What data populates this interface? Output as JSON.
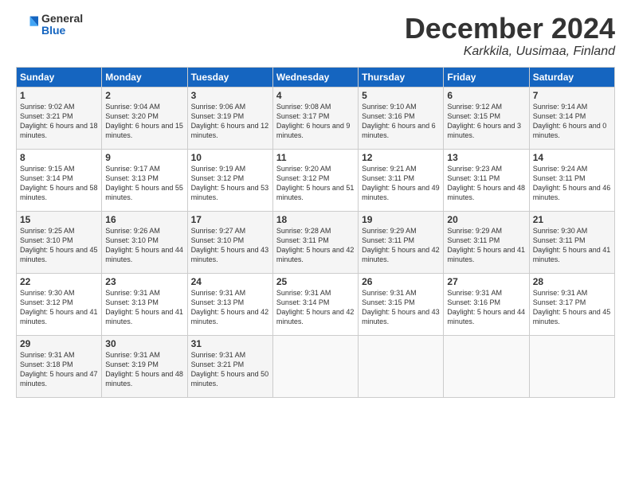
{
  "header": {
    "logo_general": "General",
    "logo_blue": "Blue",
    "month": "December 2024",
    "location": "Karkkila, Uusimaa, Finland"
  },
  "days_of_week": [
    "Sunday",
    "Monday",
    "Tuesday",
    "Wednesday",
    "Thursday",
    "Friday",
    "Saturday"
  ],
  "weeks": [
    [
      {
        "day": "1",
        "sunrise": "Sunrise: 9:02 AM",
        "sunset": "Sunset: 3:21 PM",
        "daylight": "Daylight: 6 hours and 18 minutes."
      },
      {
        "day": "2",
        "sunrise": "Sunrise: 9:04 AM",
        "sunset": "Sunset: 3:20 PM",
        "daylight": "Daylight: 6 hours and 15 minutes."
      },
      {
        "day": "3",
        "sunrise": "Sunrise: 9:06 AM",
        "sunset": "Sunset: 3:19 PM",
        "daylight": "Daylight: 6 hours and 12 minutes."
      },
      {
        "day": "4",
        "sunrise": "Sunrise: 9:08 AM",
        "sunset": "Sunset: 3:17 PM",
        "daylight": "Daylight: 6 hours and 9 minutes."
      },
      {
        "day": "5",
        "sunrise": "Sunrise: 9:10 AM",
        "sunset": "Sunset: 3:16 PM",
        "daylight": "Daylight: 6 hours and 6 minutes."
      },
      {
        "day": "6",
        "sunrise": "Sunrise: 9:12 AM",
        "sunset": "Sunset: 3:15 PM",
        "daylight": "Daylight: 6 hours and 3 minutes."
      },
      {
        "day": "7",
        "sunrise": "Sunrise: 9:14 AM",
        "sunset": "Sunset: 3:14 PM",
        "daylight": "Daylight: 6 hours and 0 minutes."
      }
    ],
    [
      {
        "day": "8",
        "sunrise": "Sunrise: 9:15 AM",
        "sunset": "Sunset: 3:14 PM",
        "daylight": "Daylight: 5 hours and 58 minutes."
      },
      {
        "day": "9",
        "sunrise": "Sunrise: 9:17 AM",
        "sunset": "Sunset: 3:13 PM",
        "daylight": "Daylight: 5 hours and 55 minutes."
      },
      {
        "day": "10",
        "sunrise": "Sunrise: 9:19 AM",
        "sunset": "Sunset: 3:12 PM",
        "daylight": "Daylight: 5 hours and 53 minutes."
      },
      {
        "day": "11",
        "sunrise": "Sunrise: 9:20 AM",
        "sunset": "Sunset: 3:12 PM",
        "daylight": "Daylight: 5 hours and 51 minutes."
      },
      {
        "day": "12",
        "sunrise": "Sunrise: 9:21 AM",
        "sunset": "Sunset: 3:11 PM",
        "daylight": "Daylight: 5 hours and 49 minutes."
      },
      {
        "day": "13",
        "sunrise": "Sunrise: 9:23 AM",
        "sunset": "Sunset: 3:11 PM",
        "daylight": "Daylight: 5 hours and 48 minutes."
      },
      {
        "day": "14",
        "sunrise": "Sunrise: 9:24 AM",
        "sunset": "Sunset: 3:11 PM",
        "daylight": "Daylight: 5 hours and 46 minutes."
      }
    ],
    [
      {
        "day": "15",
        "sunrise": "Sunrise: 9:25 AM",
        "sunset": "Sunset: 3:10 PM",
        "daylight": "Daylight: 5 hours and 45 minutes."
      },
      {
        "day": "16",
        "sunrise": "Sunrise: 9:26 AM",
        "sunset": "Sunset: 3:10 PM",
        "daylight": "Daylight: 5 hours and 44 minutes."
      },
      {
        "day": "17",
        "sunrise": "Sunrise: 9:27 AM",
        "sunset": "Sunset: 3:10 PM",
        "daylight": "Daylight: 5 hours and 43 minutes."
      },
      {
        "day": "18",
        "sunrise": "Sunrise: 9:28 AM",
        "sunset": "Sunset: 3:11 PM",
        "daylight": "Daylight: 5 hours and 42 minutes."
      },
      {
        "day": "19",
        "sunrise": "Sunrise: 9:29 AM",
        "sunset": "Sunset: 3:11 PM",
        "daylight": "Daylight: 5 hours and 42 minutes."
      },
      {
        "day": "20",
        "sunrise": "Sunrise: 9:29 AM",
        "sunset": "Sunset: 3:11 PM",
        "daylight": "Daylight: 5 hours and 41 minutes."
      },
      {
        "day": "21",
        "sunrise": "Sunrise: 9:30 AM",
        "sunset": "Sunset: 3:11 PM",
        "daylight": "Daylight: 5 hours and 41 minutes."
      }
    ],
    [
      {
        "day": "22",
        "sunrise": "Sunrise: 9:30 AM",
        "sunset": "Sunset: 3:12 PM",
        "daylight": "Daylight: 5 hours and 41 minutes."
      },
      {
        "day": "23",
        "sunrise": "Sunrise: 9:31 AM",
        "sunset": "Sunset: 3:13 PM",
        "daylight": "Daylight: 5 hours and 41 minutes."
      },
      {
        "day": "24",
        "sunrise": "Sunrise: 9:31 AM",
        "sunset": "Sunset: 3:13 PM",
        "daylight": "Daylight: 5 hours and 42 minutes."
      },
      {
        "day": "25",
        "sunrise": "Sunrise: 9:31 AM",
        "sunset": "Sunset: 3:14 PM",
        "daylight": "Daylight: 5 hours and 42 minutes."
      },
      {
        "day": "26",
        "sunrise": "Sunrise: 9:31 AM",
        "sunset": "Sunset: 3:15 PM",
        "daylight": "Daylight: 5 hours and 43 minutes."
      },
      {
        "day": "27",
        "sunrise": "Sunrise: 9:31 AM",
        "sunset": "Sunset: 3:16 PM",
        "daylight": "Daylight: 5 hours and 44 minutes."
      },
      {
        "day": "28",
        "sunrise": "Sunrise: 9:31 AM",
        "sunset": "Sunset: 3:17 PM",
        "daylight": "Daylight: 5 hours and 45 minutes."
      }
    ],
    [
      {
        "day": "29",
        "sunrise": "Sunrise: 9:31 AM",
        "sunset": "Sunset: 3:18 PM",
        "daylight": "Daylight: 5 hours and 47 minutes."
      },
      {
        "day": "30",
        "sunrise": "Sunrise: 9:31 AM",
        "sunset": "Sunset: 3:19 PM",
        "daylight": "Daylight: 5 hours and 48 minutes."
      },
      {
        "day": "31",
        "sunrise": "Sunrise: 9:31 AM",
        "sunset": "Sunset: 3:21 PM",
        "daylight": "Daylight: 5 hours and 50 minutes."
      },
      null,
      null,
      null,
      null
    ]
  ]
}
